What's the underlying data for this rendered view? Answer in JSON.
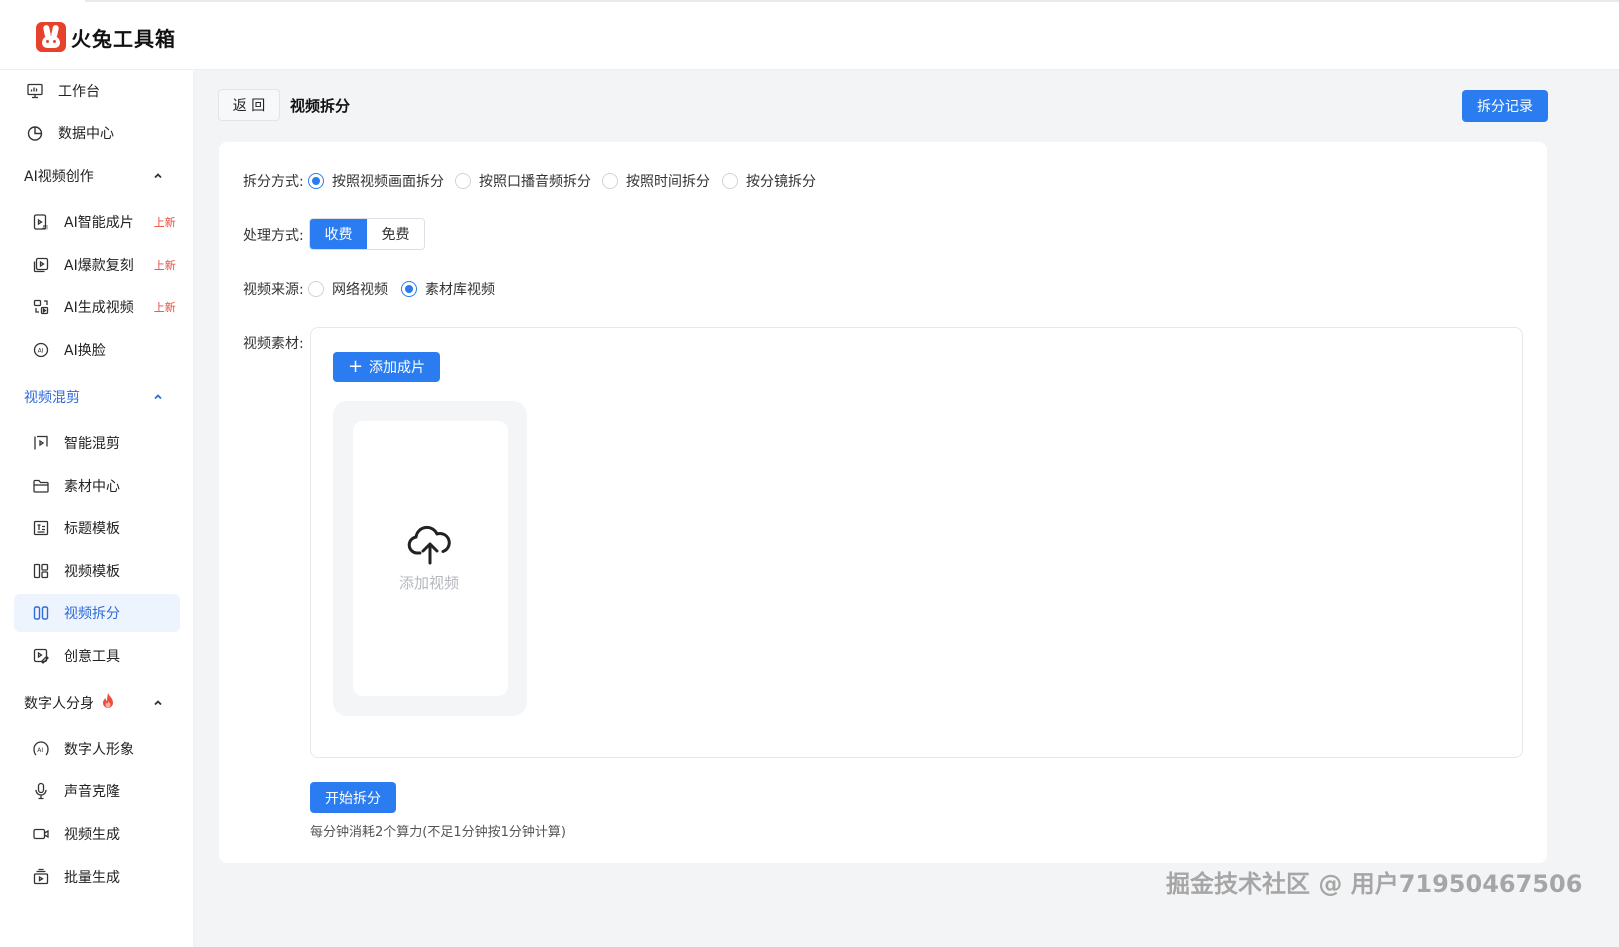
{
  "app": {
    "name": "火兔工具箱",
    "brand_color": "#e8412b",
    "accent": "#2b7cf0"
  },
  "sidebar": {
    "workbench": "工作台",
    "data_center": "数据中心",
    "groups": [
      {
        "label": "AI视频创作",
        "items": [
          {
            "label": "AI智能成片",
            "badge": "上新"
          },
          {
            "label": "AI爆款复刻",
            "badge": "上新"
          },
          {
            "label": "AI生成视频",
            "badge": "上新"
          },
          {
            "label": "AI换脸"
          }
        ]
      },
      {
        "label": "视频混剪",
        "items": [
          {
            "label": "智能混剪"
          },
          {
            "label": "素材中心"
          },
          {
            "label": "标题模板"
          },
          {
            "label": "视频模板"
          },
          {
            "label": "视频拆分"
          },
          {
            "label": "创意工具"
          }
        ]
      },
      {
        "label": "数字人分身",
        "items": [
          {
            "label": "数字人形象"
          },
          {
            "label": "声音克隆"
          },
          {
            "label": "视频生成"
          },
          {
            "label": "批量生成"
          }
        ]
      }
    ]
  },
  "header": {
    "back": "返 回",
    "title": "视频拆分",
    "record": "拆分记录"
  },
  "form": {
    "split_mode": {
      "label": "拆分方式:",
      "options": [
        "按照视频画面拆分",
        "按照口播音频拆分",
        "按照时间拆分",
        "按分镜拆分"
      ],
      "selected": "按照视频画面拆分"
    },
    "process_mode": {
      "label": "处理方式:",
      "options": [
        "收费",
        "免费"
      ],
      "selected": "收费"
    },
    "source": {
      "label": "视频来源:",
      "options": [
        "网络视频",
        "素材库视频"
      ],
      "selected": "素材库视频"
    },
    "material": {
      "label": "视频素材:",
      "add_button": "添加成片",
      "upload_text": "添加视频"
    },
    "start_button": "开始拆分",
    "hint": "每分钟消耗2个算力(不足1分钟按1分钟计算)"
  },
  "watermark": "掘金技术社区 @ 用户71950467506"
}
